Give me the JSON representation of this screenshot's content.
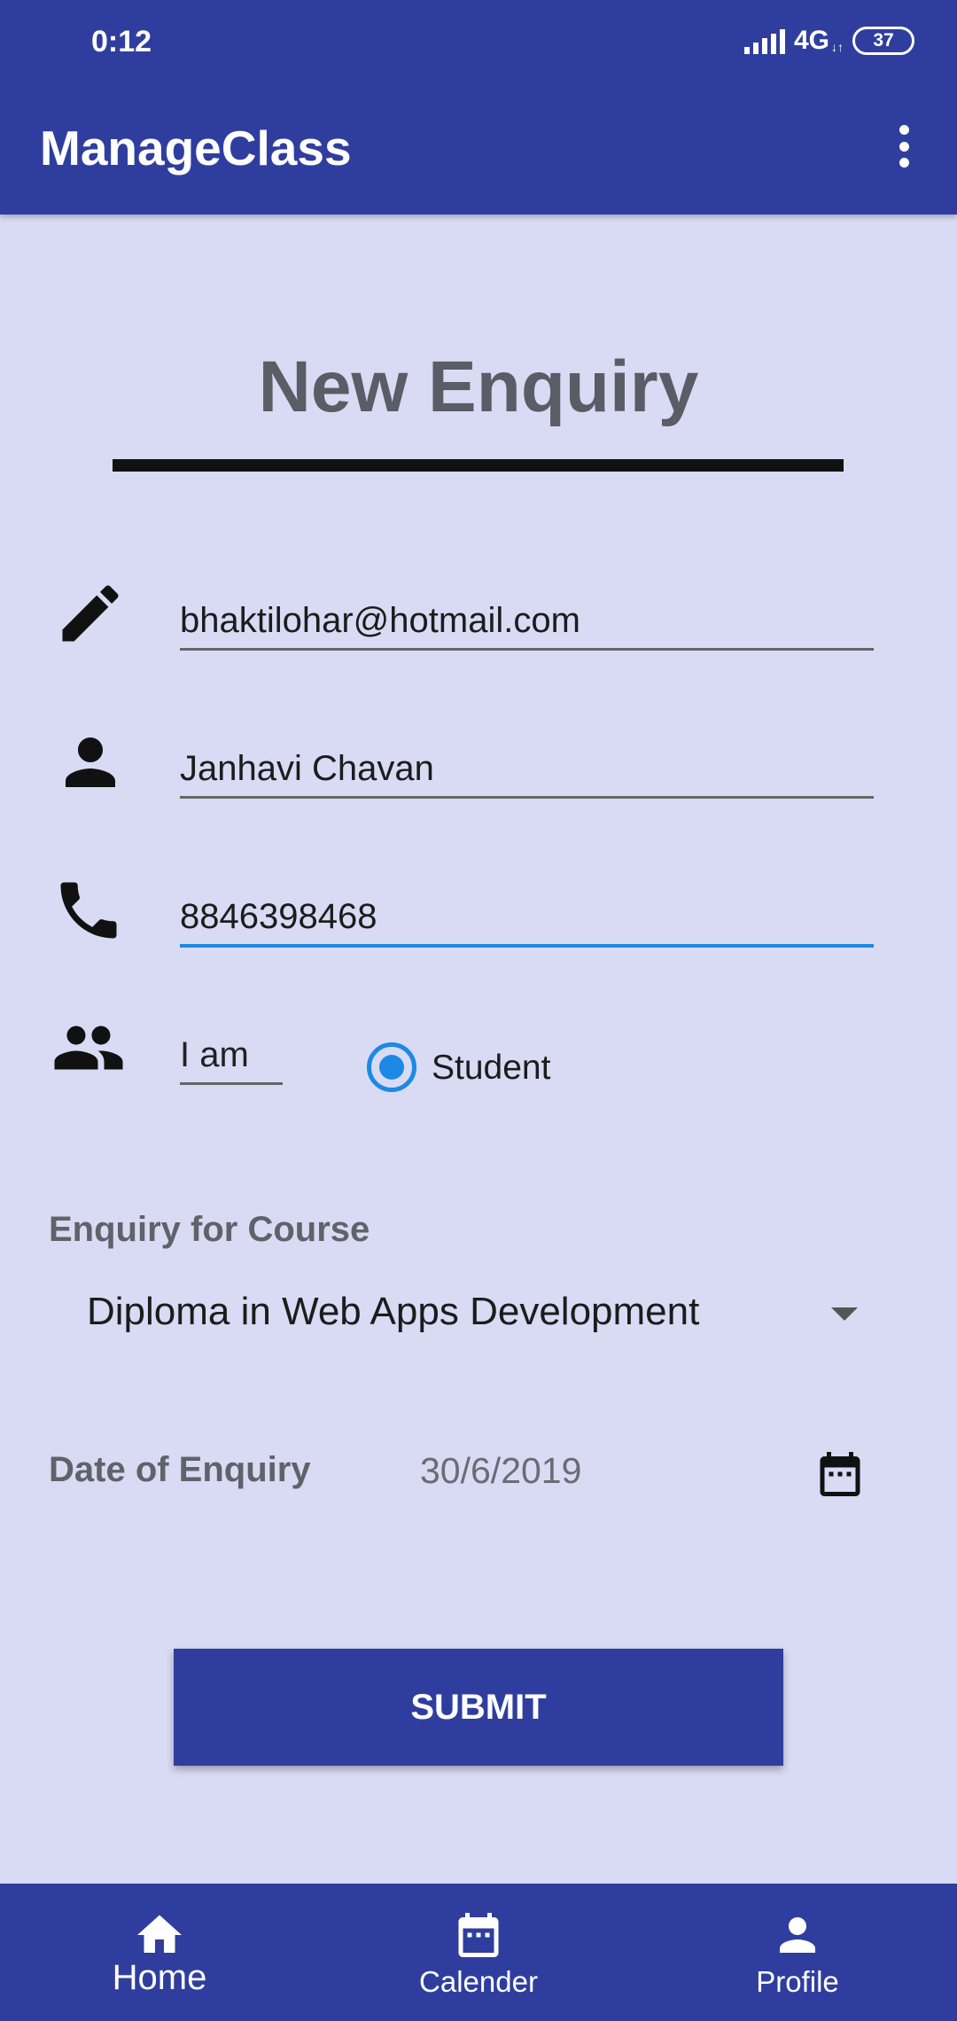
{
  "status_bar": {
    "time": "0:12",
    "network": "4G",
    "battery": "37"
  },
  "app_bar": {
    "title": "ManageClass",
    "menu_icon": "more-vert-icon"
  },
  "form": {
    "heading": "New Enquiry",
    "email": {
      "icon": "pencil-icon",
      "value": "bhaktilohar@hotmail.com"
    },
    "name": {
      "icon": "person-icon",
      "value": "Janhavi Chavan"
    },
    "phone": {
      "icon": "phone-icon",
      "value": "8846398468"
    },
    "role": {
      "icon": "people-icon",
      "prefix": "I am",
      "option": "Student",
      "selected": true
    },
    "course": {
      "label": "Enquiry for Course",
      "selected": "Diploma in Web Apps Development"
    },
    "date": {
      "label": "Date of Enquiry",
      "value": "30/6/2019",
      "icon": "calendar-icon"
    },
    "submit_label": "SUBMIT"
  },
  "bottom_nav": {
    "items": [
      {
        "label": "Home",
        "icon": "home-icon"
      },
      {
        "label": "Calender",
        "icon": "calendar-icon"
      },
      {
        "label": "Profile",
        "icon": "person-icon"
      }
    ]
  },
  "colors": {
    "primary": "#2f3e9e",
    "background": "#d8dbf3",
    "accent": "#1e88e5"
  }
}
